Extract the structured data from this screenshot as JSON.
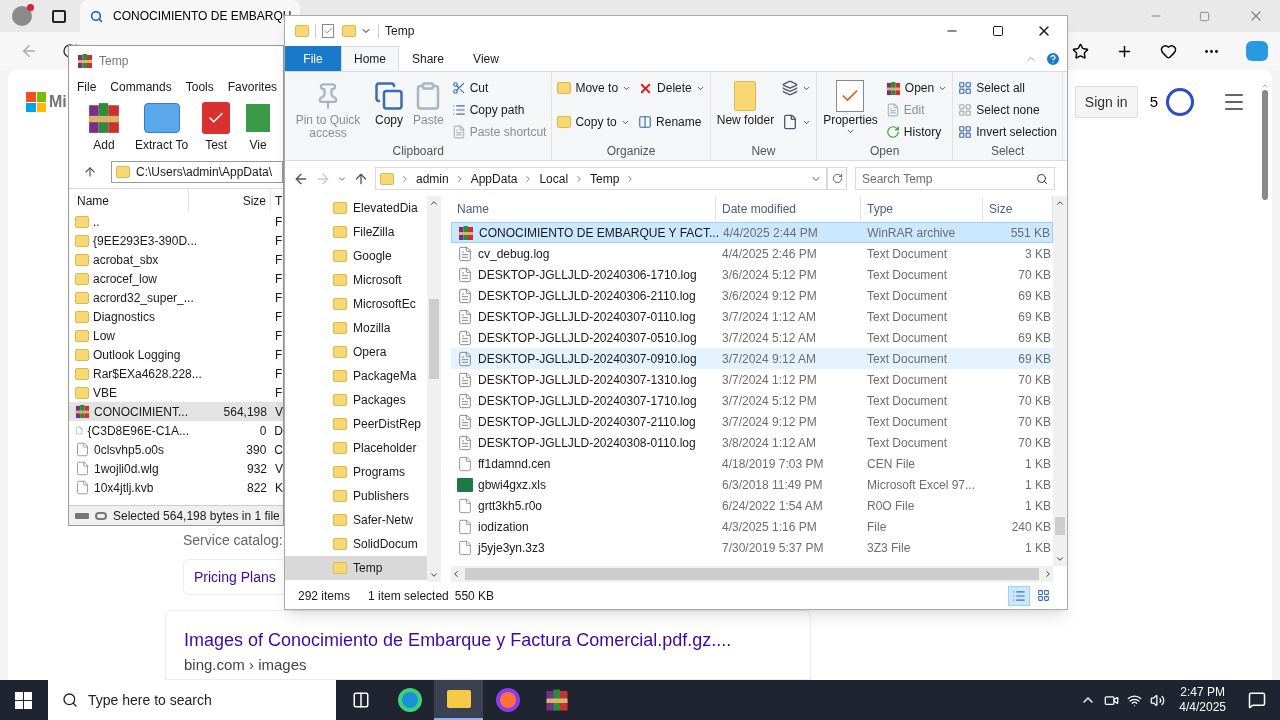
{
  "browser": {
    "tab_title": "CONOCIMIENTO DE EMBARQU",
    "logo_text": "Mi",
    "sign_in": "Sign in",
    "reward_count": "5",
    "service_label": "Service catalog:",
    "pricing_button": "Pricing Plans",
    "result_title": "Images of Conocimiento de Embarque y Factura Comercial.pdf.gz....",
    "result_url": "bing.com › images"
  },
  "winrar": {
    "title": "Temp",
    "menu": [
      "File",
      "Commands",
      "Tools",
      "Favorites"
    ],
    "tools": [
      "Add",
      "Extract To",
      "Test",
      "Vie"
    ],
    "path": "C:\\Users\\admin\\AppData\\",
    "columns": [
      "Name",
      "Size",
      "T"
    ],
    "rows": [
      {
        "name": "..",
        "size": "",
        "column_3": "F",
        "kind": "folder",
        "selected": false
      },
      {
        "name": "{9EE293E3-390D...",
        "size": "",
        "column_3": "F",
        "kind": "folder",
        "selected": false
      },
      {
        "name": "acrobat_sbx",
        "size": "",
        "column_3": "F",
        "kind": "folder",
        "selected": false
      },
      {
        "name": "acrocef_low",
        "size": "",
        "column_3": "F",
        "kind": "folder",
        "selected": false
      },
      {
        "name": "acrord32_super_...",
        "size": "",
        "column_3": "F",
        "kind": "folder",
        "selected": false
      },
      {
        "name": "Diagnostics",
        "size": "",
        "column_3": "F",
        "kind": "folder",
        "selected": false
      },
      {
        "name": "Low",
        "size": "",
        "column_3": "F",
        "kind": "folder",
        "selected": false
      },
      {
        "name": "Outlook Logging",
        "size": "",
        "column_3": "F",
        "kind": "folder",
        "selected": false
      },
      {
        "name": "Rar$EXa4628.228...",
        "size": "",
        "column_3": "F",
        "kind": "folder",
        "selected": false
      },
      {
        "name": "VBE",
        "size": "",
        "column_3": "F",
        "kind": "folder",
        "selected": false
      },
      {
        "name": "CONOCIMIENT...",
        "size": "564,198",
        "column_3": "V",
        "kind": "archive",
        "selected": true
      },
      {
        "name": "{C3D8E96E-C1A...",
        "size": "0",
        "column_3": "D",
        "kind": "file",
        "selected": false
      },
      {
        "name": "0clsvhp5.o0s",
        "size": "390",
        "column_3": "C",
        "kind": "file",
        "selected": false
      },
      {
        "name": "1wojli0d.wlg",
        "size": "932",
        "column_3": "V",
        "kind": "file",
        "selected": false
      },
      {
        "name": "10x4jtlj.kvb",
        "size": "822",
        "column_3": "K",
        "kind": "file",
        "selected": false
      }
    ],
    "status": "Selected 564,198 bytes in 1 file"
  },
  "explorer": {
    "title": "Temp",
    "tabs": [
      {
        "label": "File",
        "kind": "file",
        "selected": false
      },
      {
        "label": "Home",
        "kind": "tab",
        "selected": true
      },
      {
        "label": "Share",
        "kind": "tab",
        "selected": false
      },
      {
        "label": "View",
        "kind": "tab",
        "selected": false
      }
    ],
    "ribbon": [
      {
        "label": "Clipboard",
        "items": [
          {
            "kind": "large",
            "label": "Pin to Quick access",
            "disabled": true,
            "dropdown": false
          },
          {
            "kind": "large",
            "label": "Copy",
            "disabled": false,
            "dropdown": false
          },
          {
            "kind": "large",
            "label": "Paste",
            "disabled": true,
            "dropdown": false
          },
          {
            "kind": "stack",
            "items": [
              {
                "label": "Cut",
                "disabled": false,
                "dropdown": false
              },
              {
                "label": "Copy path",
                "disabled": false,
                "dropdown": false
              },
              {
                "label": "Paste shortcut",
                "disabled": true,
                "dropdown": false
              }
            ]
          }
        ]
      },
      {
        "label": "Organize",
        "items": [
          {
            "kind": "stack",
            "items": [
              {
                "label": "Move to",
                "disabled": false,
                "dropdown": true
              },
              {
                "label": "Copy to",
                "disabled": false,
                "dropdown": true
              }
            ]
          },
          {
            "kind": "stack",
            "items": [
              {
                "label": "Delete",
                "disabled": false,
                "dropdown": true
              },
              {
                "label": "Rename",
                "disabled": false,
                "dropdown": false
              }
            ]
          }
        ]
      },
      {
        "label": "New",
        "items": [
          {
            "kind": "large",
            "label": "New folder",
            "disabled": false,
            "dropdown": false
          },
          {
            "kind": "stack",
            "items": [
              {
                "disabled": false,
                "dropdown": true
              },
              {
                "disabled": false,
                "dropdown": true
              }
            ]
          }
        ]
      },
      {
        "label": "Open",
        "items": [
          {
            "kind": "large",
            "label": "Properties",
            "disabled": false,
            "dropdown": true
          },
          {
            "kind": "stack",
            "items": [
              {
                "label": "Open",
                "disabled": false,
                "dropdown": true
              },
              {
                "label": "Edit",
                "disabled": true,
                "dropdown": false
              },
              {
                "label": "History",
                "disabled": false,
                "dropdown": false
              }
            ]
          }
        ]
      },
      {
        "label": "Select",
        "items": [
          {
            "kind": "stack",
            "items": [
              {
                "label": "Select all",
                "disabled": false,
                "dropdown": false
              },
              {
                "label": "Select none",
                "disabled": false,
                "dropdown": false
              },
              {
                "label": "Invert selection",
                "disabled": false,
                "dropdown": false
              }
            ]
          }
        ]
      }
    ],
    "breadcrumb": [
      "admin",
      "AppData",
      "Local",
      "Temp"
    ],
    "search": {
      "placeholder": "Search Temp"
    },
    "nav": [
      {
        "label": "ElevatedDia",
        "selected": false
      },
      {
        "label": "FileZilla",
        "selected": false
      },
      {
        "label": "Google",
        "selected": false
      },
      {
        "label": "Microsoft",
        "selected": false
      },
      {
        "label": "MicrosoftEc",
        "selected": false
      },
      {
        "label": "Mozilla",
        "selected": false
      },
      {
        "label": "Opera",
        "selected": false
      },
      {
        "label": "PackageMa",
        "selected": false
      },
      {
        "label": "Packages",
        "selected": false
      },
      {
        "label": "PeerDistRep",
        "selected": false
      },
      {
        "label": "Placeholder",
        "selected": false
      },
      {
        "label": "Programs",
        "selected": false
      },
      {
        "label": "Publishers",
        "selected": false
      },
      {
        "label": "Safer-Netw",
        "selected": false
      },
      {
        "label": "SolidDocum",
        "selected": false
      },
      {
        "label": "Temp",
        "selected": true
      }
    ],
    "columns": [
      "Name",
      "Date modified",
      "Type",
      "Size"
    ],
    "rows": [
      {
        "name": "CONOCIMIENTO DE EMBARQUE Y FACT...",
        "date": "4/4/2025 2:44 PM",
        "type": "WinRAR archive",
        "size": "551 KB",
        "kind": "archive",
        "selected": true,
        "hovered": false
      },
      {
        "name": "cv_debug.log",
        "date": "4/4/2025 2:46 PM",
        "type": "Text Document",
        "size": "3 KB",
        "kind": "text",
        "selected": false,
        "hovered": false
      },
      {
        "name": "DESKTOP-JGLLJLD-20240306-1710.log",
        "date": "3/6/2024 5:12 PM",
        "type": "Text Document",
        "size": "70 KB",
        "kind": "text",
        "selected": false,
        "hovered": false
      },
      {
        "name": "DESKTOP-JGLLJLD-20240306-2110.log",
        "date": "3/6/2024 9:12 PM",
        "type": "Text Document",
        "size": "69 KB",
        "kind": "text",
        "selected": false,
        "hovered": false
      },
      {
        "name": "DESKTOP-JGLLJLD-20240307-0110.log",
        "date": "3/7/2024 1:12 AM",
        "type": "Text Document",
        "size": "69 KB",
        "kind": "text",
        "selected": false,
        "hovered": false
      },
      {
        "name": "DESKTOP-JGLLJLD-20240307-0510.log",
        "date": "3/7/2024 5:12 AM",
        "type": "Text Document",
        "size": "69 KB",
        "kind": "text",
        "selected": false,
        "hovered": false
      },
      {
        "name": "DESKTOP-JGLLJLD-20240307-0910.log",
        "date": "3/7/2024 9:12 AM",
        "type": "Text Document",
        "size": "69 KB",
        "kind": "text",
        "selected": false,
        "hovered": true
      },
      {
        "name": "DESKTOP-JGLLJLD-20240307-1310.log",
        "date": "3/7/2024 1:12 PM",
        "type": "Text Document",
        "size": "70 KB",
        "kind": "text",
        "selected": false,
        "hovered": false
      },
      {
        "name": "DESKTOP-JGLLJLD-20240307-1710.log",
        "date": "3/7/2024 5:12 PM",
        "type": "Text Document",
        "size": "70 KB",
        "kind": "text",
        "selected": false,
        "hovered": false
      },
      {
        "name": "DESKTOP-JGLLJLD-20240307-2110.log",
        "date": "3/7/2024 9:12 PM",
        "type": "Text Document",
        "size": "70 KB",
        "kind": "text",
        "selected": false,
        "hovered": false
      },
      {
        "name": "DESKTOP-JGLLJLD-20240308-0110.log",
        "date": "3/8/2024 1:12 AM",
        "type": "Text Document",
        "size": "70 KB",
        "kind": "text",
        "selected": false,
        "hovered": false
      },
      {
        "name": "ff1damnd.cen",
        "date": "4/18/2019 7:03 PM",
        "type": "CEN File",
        "size": "1 KB",
        "kind": "blank",
        "selected": false,
        "hovered": false
      },
      {
        "name": "gbwi4gxz.xls",
        "date": "6/3/2018 11:49 PM",
        "type": "Microsoft Excel 97...",
        "size": "1 KB",
        "kind": "excel",
        "selected": false,
        "hovered": false
      },
      {
        "name": "grtt3kh5.r0o",
        "date": "6/24/2022 1:54 AM",
        "type": "R0O File",
        "size": "1 KB",
        "kind": "blank",
        "selected": false,
        "hovered": false
      },
      {
        "name": "iodization",
        "date": "4/3/2025 1:16 PM",
        "type": "File",
        "size": "240 KB",
        "kind": "blank",
        "selected": false,
        "hovered": false
      },
      {
        "name": "j5yje3yn.3z3",
        "date": "7/30/2019 5:37 PM",
        "type": "3Z3 File",
        "size": "1 KB",
        "kind": "blank",
        "selected": false,
        "hovered": false
      }
    ],
    "status": {
      "count": "292 items",
      "selection": "1 item selected",
      "size": "550 KB"
    },
    "views": [
      {
        "kind": "details",
        "selected": true
      },
      {
        "kind": "tiles",
        "selected": false
      }
    ]
  },
  "taskbar": {
    "search_placeholder": "Type here to search",
    "apps": [
      {
        "kind": "taskview",
        "active": false
      },
      {
        "kind": "edge",
        "active": false
      },
      {
        "kind": "explorer",
        "active": true
      },
      {
        "kind": "firefox",
        "active": false
      },
      {
        "kind": "winrar",
        "active": false
      }
    ],
    "time": "2:47 PM",
    "date": "4/4/2025"
  }
}
